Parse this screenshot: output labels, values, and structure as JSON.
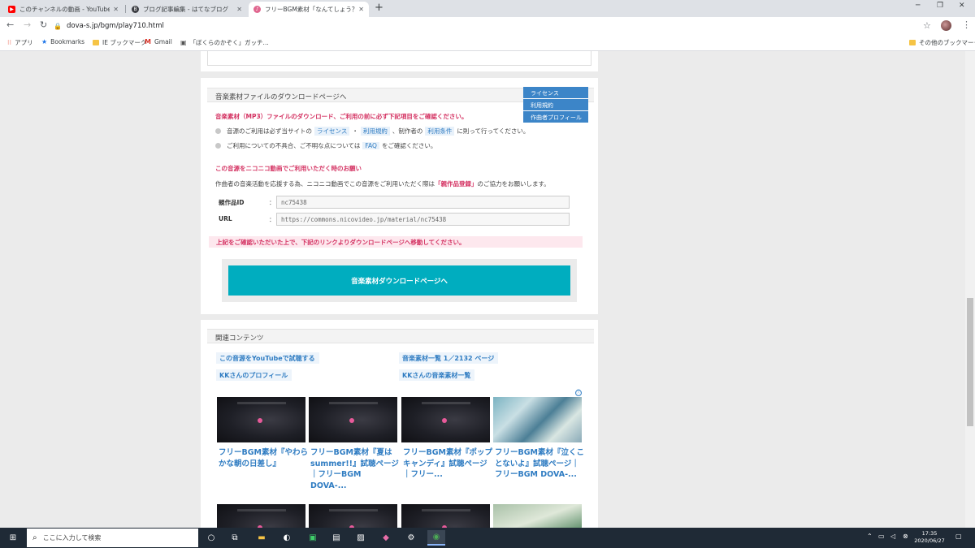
{
  "browser": {
    "tabs": [
      {
        "label": "このチャンネルの動画 - YouTube Studio",
        "favicon": "youtube-icon",
        "color": "#ff0000",
        "active": false
      },
      {
        "label": "ブログ記事編集 - はてなブログ",
        "favicon": "hatena-icon",
        "color": "#3d3f44",
        "active": false
      },
      {
        "label": "フリーBGM素材「なんてしょう？」試聴",
        "favicon": "dova-icon",
        "color": "#e0668f",
        "active": true
      }
    ],
    "url": "dova-s.jp/bgm/play710.html",
    "bookmarks_bar": [
      {
        "label": "アプリ",
        "icon": "apps-grid-icon"
      },
      {
        "label": "Bookmarks",
        "icon": "star-icon"
      },
      {
        "label": "IE ブックマーク",
        "icon": "folder-icon"
      },
      {
        "label": "Gmail",
        "icon": "gmail-icon"
      },
      {
        "label": "「ぼくらのかぞく」ガッチ...",
        "icon": "page-icon"
      }
    ],
    "other_bookmarks": "その他のブックマーク"
  },
  "download_section": {
    "title": "音楽素材ファイルのダウンロードページへ",
    "side_links": [
      "ライセンス",
      "利用規約",
      "作曲者プロフィール"
    ],
    "warning": "音楽素材（MP3）ファイルのダウンロード、ご利用の前に必ず下記項目をご確認ください。",
    "note1": {
      "pre": "音源のご利用は必ず当サイトの",
      "link1": "ライセンス",
      "sep": "・",
      "link2": "利用規約",
      "mid": "、制作者の",
      "link3": "利用条件",
      "post": "に則って行ってください。"
    },
    "note2": {
      "pre": "ご利用についての不具合、ご不明な点については",
      "link": "FAQ",
      "post": "をご確認ください。"
    },
    "nico_heading": "この音源をニコニコ動画でご利用いただく時のお願い",
    "nico_text": {
      "pre": "作曲者の音楽活動を応援する為、ニコニコ動画でこの音源をご利用いただく際は",
      "highlight": "「親作品登録」",
      "post": "のご協力をお願いします。"
    },
    "fields": [
      {
        "label": "親作品ID",
        "colon": "：",
        "value": "nc75438"
      },
      {
        "label": "URL",
        "colon": "：",
        "value": "https://commons.nicovideo.jp/material/nc75438"
      }
    ],
    "confirm_text": "上記をご確認いただいた上で、下記のリンクよりダウンロードページへ移動してください。",
    "download_button": "音楽素材ダウンロードページへ"
  },
  "related_section": {
    "title": "関連コンテンツ",
    "links": [
      "この音源をYouTubeで試聴する",
      "音楽素材一覧 1／2132 ページ",
      "KKさんのプロフィール",
      "KKさんの音楽素材一覧"
    ],
    "adchoices": "ⓘ",
    "thumbnails": [
      {
        "title": "フリーBGM素材『やわらかな朝の日差し』"
      },
      {
        "title": "フリーBGM素材『夏はsummer!!』試聴ページ｜フリーBGM DOVA-..."
      },
      {
        "title": "フリーBGM素材『ポップキャンディ』試聴ページ｜フリー..."
      },
      {
        "title": "フリーBGM素材『泣くことないよ』試聴ページ｜フリーBGM DOVA-..."
      }
    ]
  },
  "taskbar": {
    "search_placeholder": "ここに入力して検索",
    "time": "17:35",
    "date": "2020/06/27"
  }
}
